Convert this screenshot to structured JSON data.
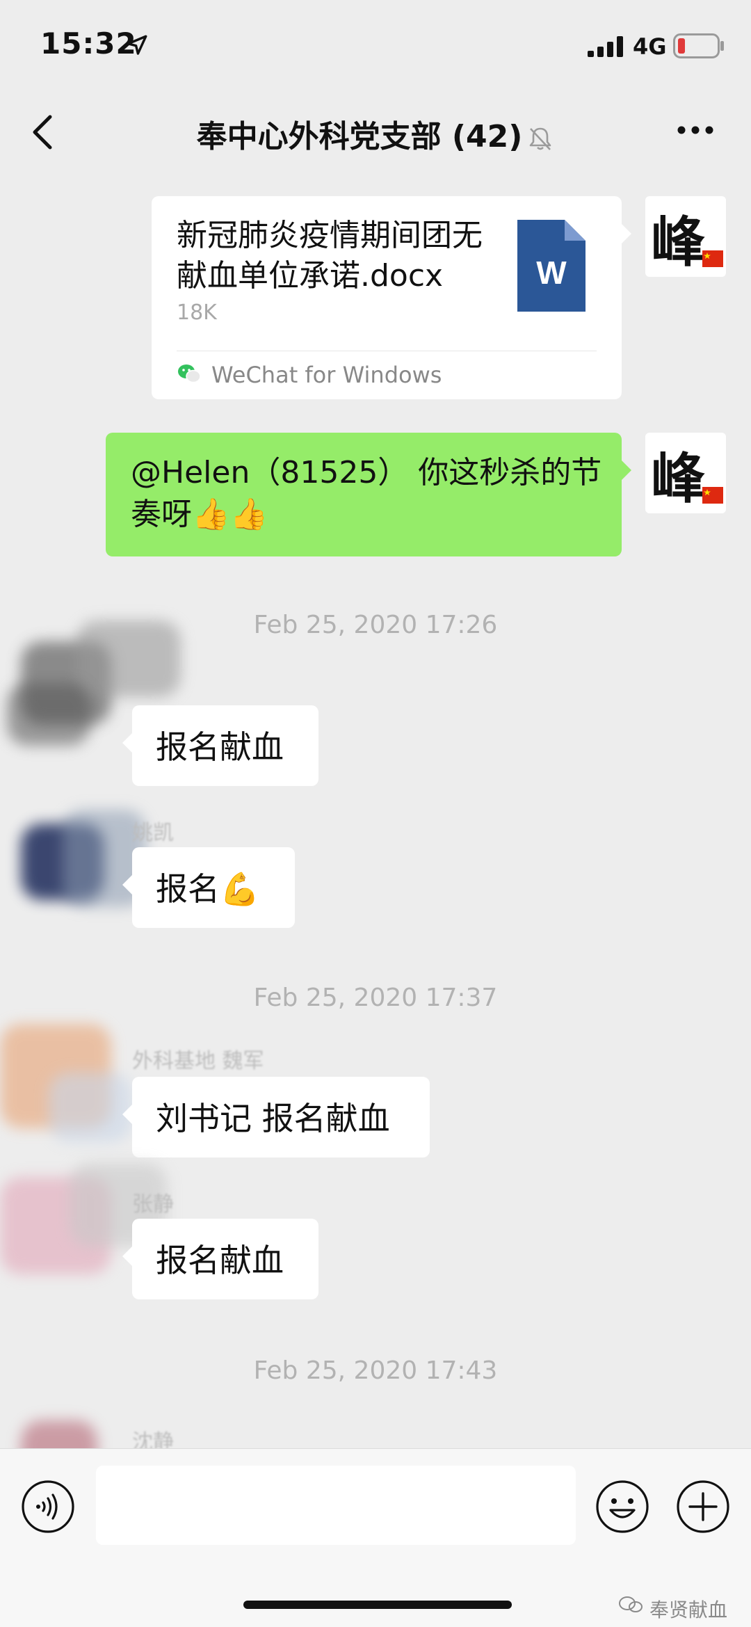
{
  "status_bar": {
    "time": "15:32",
    "network": "4G",
    "battery_color": "#e03a3a"
  },
  "nav": {
    "title": "奉中心外科党支部 (42)"
  },
  "messages": {
    "file": {
      "name": "新冠肺炎疫情期间团无献血单位承诺.docx",
      "size": "18K",
      "source": "WeChat for Windows",
      "doc_icon_letter": "W",
      "doc_icon_color": "#2b5797"
    },
    "self_text": "@Helen（81525） 你这秒杀的节奏呀👍👍",
    "self_avatar_char": "峰",
    "timestamps": [
      "Feb 25, 2020 17:26",
      "Feb 25, 2020 17:37",
      "Feb 25, 2020 17:43"
    ],
    "incoming": [
      {
        "sender": "",
        "text": "报名献血"
      },
      {
        "sender": "姚凯",
        "text": "报名💪"
      },
      {
        "sender": "外科基地 魏军",
        "text": "刘书记 报名献血"
      },
      {
        "sender": "张静",
        "text": "报名献血"
      },
      {
        "sender": "沈静",
        "text": ""
      }
    ]
  },
  "input_bar": {
    "placeholder": "",
    "watermark": "奉贤献血"
  },
  "colors": {
    "self_bubble": "#95ec69",
    "incoming_bubble": "#ffffff",
    "background": "#ededed"
  }
}
